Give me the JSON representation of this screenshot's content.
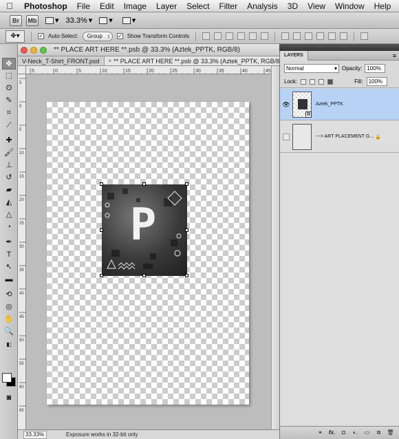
{
  "menubar": {
    "apple_icon": "apple-logo-icon",
    "app_name": "Photoshop",
    "items": [
      "File",
      "Edit",
      "Image",
      "Layer",
      "Select",
      "Filter",
      "Analysis",
      "3D",
      "View",
      "Window",
      "Help"
    ]
  },
  "appbar": {
    "bridge": "Br",
    "mini_bridge": "Mb",
    "zoom": "33.3%"
  },
  "options": {
    "auto_select_label": "Auto-Select:",
    "auto_select_checked": "✓",
    "auto_select_target": "Group",
    "show_transform_label": "Show Transform Controls",
    "show_transform_checked": "✓"
  },
  "document": {
    "title": "** PLACE ART HERE **.psb @ 33.3% (Aztek_PPTK, RGB/8)",
    "tabs": [
      {
        "label": "V-Neck_T-Shirt_FRONT.psd"
      },
      {
        "label": "** PLACE ART HERE **.psb @ 33.3% (Aztek_PPTK, RGB/8)"
      }
    ],
    "tab_close": "×",
    "traffic_colors": [
      "#ec5b52",
      "#e8b43a",
      "#62c34d"
    ],
    "ruler_ticks": [
      "5",
      "0",
      "5",
      "10",
      "15",
      "20",
      "25",
      "30",
      "35",
      "40",
      "45"
    ],
    "vruler_ticks": [
      "5",
      "0",
      "5",
      "10",
      "15",
      "20",
      "25",
      "30",
      "35",
      "40",
      "45",
      "50",
      "55",
      "60",
      "65"
    ],
    "status_zoom": "33.33%",
    "status_message": "Exposure works in 32-bit only",
    "art_letter": "P"
  },
  "layers": {
    "tab_label": "LAYERS",
    "blend_mode": "Normal",
    "opacity_label": "Opacity:",
    "opacity_value": "100%",
    "lock_label": "Lock:",
    "fill_label": "Fill:",
    "fill_value": "100%",
    "items": [
      {
        "name": "Aztek_PPTK",
        "visible": true,
        "selected": true
      },
      {
        "name": "---> ART PLACEMENT G...",
        "visible": false,
        "selected": false
      }
    ],
    "visible_icon": "eye-icon",
    "footer_icons": [
      "link-icon",
      "fx-icon",
      "mask-icon",
      "adjustment-icon",
      "folder-icon",
      "new-layer-icon",
      "trash-icon"
    ],
    "footer_glyphs": [
      "⚭",
      "fx.",
      "◘",
      "◐.",
      "▭",
      "⧉",
      "🗑"
    ]
  },
  "colors": {
    "selection_blue": "#b7d2f5",
    "foreground": "#ffffff",
    "background": "#000000"
  }
}
